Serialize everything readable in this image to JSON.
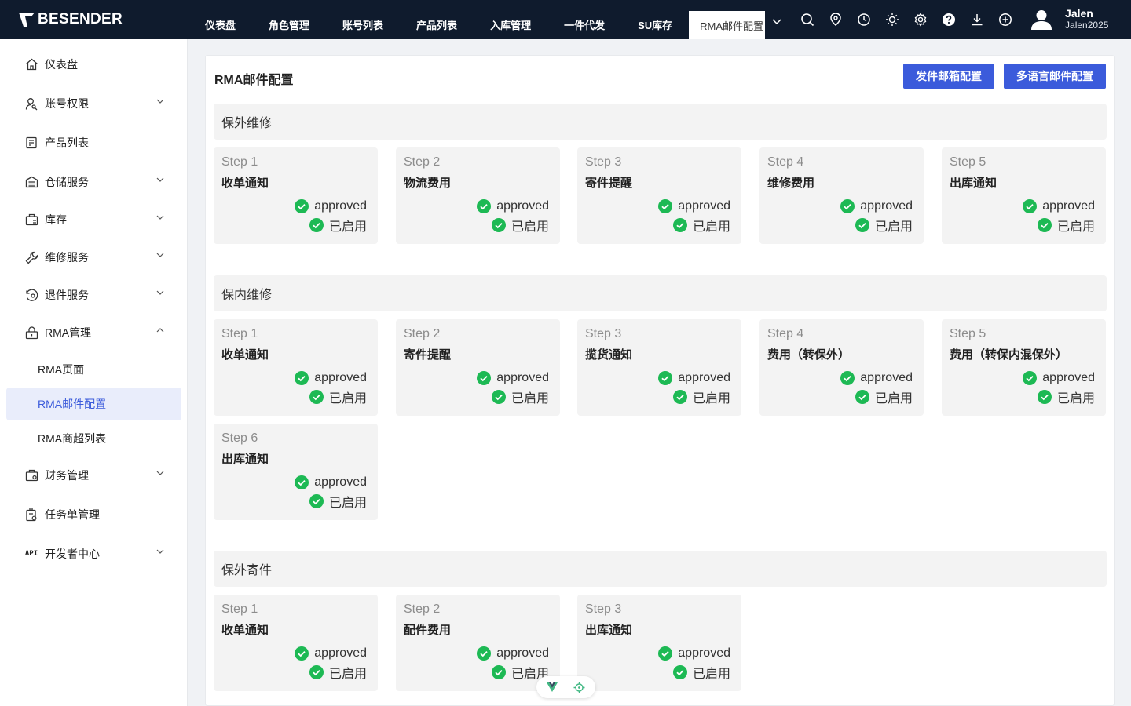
{
  "brand": {
    "name": "BESENDER",
    "accent": "#3b5bdb",
    "topbar_bg": "#0f1b2d"
  },
  "topnav": {
    "items": [
      "仪表盘",
      "角色管理",
      "账号列表",
      "产品列表",
      "入库管理",
      "一件代发",
      "SU库存"
    ],
    "active": "RMA邮件配置",
    "tools": [
      "search-icon",
      "location-icon",
      "clock-icon",
      "sun-icon",
      "gear-icon",
      "help-icon",
      "download-icon",
      "plus-circle-icon"
    ]
  },
  "user": {
    "name": "Jalen",
    "id": "Jalen2025"
  },
  "sidebar": {
    "items": [
      {
        "label": "仪表盘",
        "icon": "home-icon"
      },
      {
        "label": "账号权限",
        "icon": "user-key-icon"
      },
      {
        "label": "产品列表",
        "icon": "product-icon"
      },
      {
        "label": "仓储服务",
        "icon": "warehouse-icon"
      },
      {
        "label": "库存",
        "icon": "inventory-icon"
      },
      {
        "label": "维修服务",
        "icon": "wrench-icon"
      },
      {
        "label": "退件服务",
        "icon": "return-icon"
      },
      {
        "label": "RMA管理",
        "icon": "lock-box-icon"
      },
      {
        "label": "财务管理",
        "icon": "finance-icon"
      },
      {
        "label": "任务单管理",
        "icon": "task-icon"
      },
      {
        "label": "开发者中心",
        "icon": "api-icon",
        "prefix": "API"
      }
    ],
    "rma_sub": [
      "RMA页面",
      "RMA邮件配置",
      "RMA商超列表"
    ]
  },
  "page": {
    "title": "RMA邮件配置",
    "btn_mailbox": "发件邮箱配置",
    "btn_multilang": "多语言邮件配置"
  },
  "sections": [
    {
      "title": "保外维修",
      "steps": [
        {
          "num": "Step 1",
          "name": "收单通知",
          "status": "approved",
          "enabled": "已启用"
        },
        {
          "num": "Step 2",
          "name": "物流费用",
          "status": "approved",
          "enabled": "已启用"
        },
        {
          "num": "Step 3",
          "name": "寄件提醒",
          "status": "approved",
          "enabled": "已启用"
        },
        {
          "num": "Step 4",
          "name": "维修费用",
          "status": "approved",
          "enabled": "已启用"
        },
        {
          "num": "Step 5",
          "name": "出库通知",
          "status": "approved",
          "enabled": "已启用"
        }
      ]
    },
    {
      "title": "保内维修",
      "steps": [
        {
          "num": "Step 1",
          "name": "收单通知",
          "status": "approved",
          "enabled": "已启用"
        },
        {
          "num": "Step 2",
          "name": "寄件提醒",
          "status": "approved",
          "enabled": "已启用"
        },
        {
          "num": "Step 3",
          "name": "揽货通知",
          "status": "approved",
          "enabled": "已启用"
        },
        {
          "num": "Step 4",
          "name": "费用（转保外）",
          "status": "approved",
          "enabled": "已启用"
        },
        {
          "num": "Step 5",
          "name": "费用（转保内混保外）",
          "status": "approved",
          "enabled": "已启用"
        },
        {
          "num": "Step 6",
          "name": "出库通知",
          "status": "approved",
          "enabled": "已启用"
        }
      ]
    },
    {
      "title": "保外寄件",
      "steps": [
        {
          "num": "Step 1",
          "name": "收单通知",
          "status": "approved",
          "enabled": "已启用"
        },
        {
          "num": "Step 2",
          "name": "配件费用",
          "status": "approved",
          "enabled": "已启用"
        },
        {
          "num": "Step 3",
          "name": "出库通知",
          "status": "approved",
          "enabled": "已启用"
        }
      ]
    }
  ],
  "status_color": "#1db954"
}
